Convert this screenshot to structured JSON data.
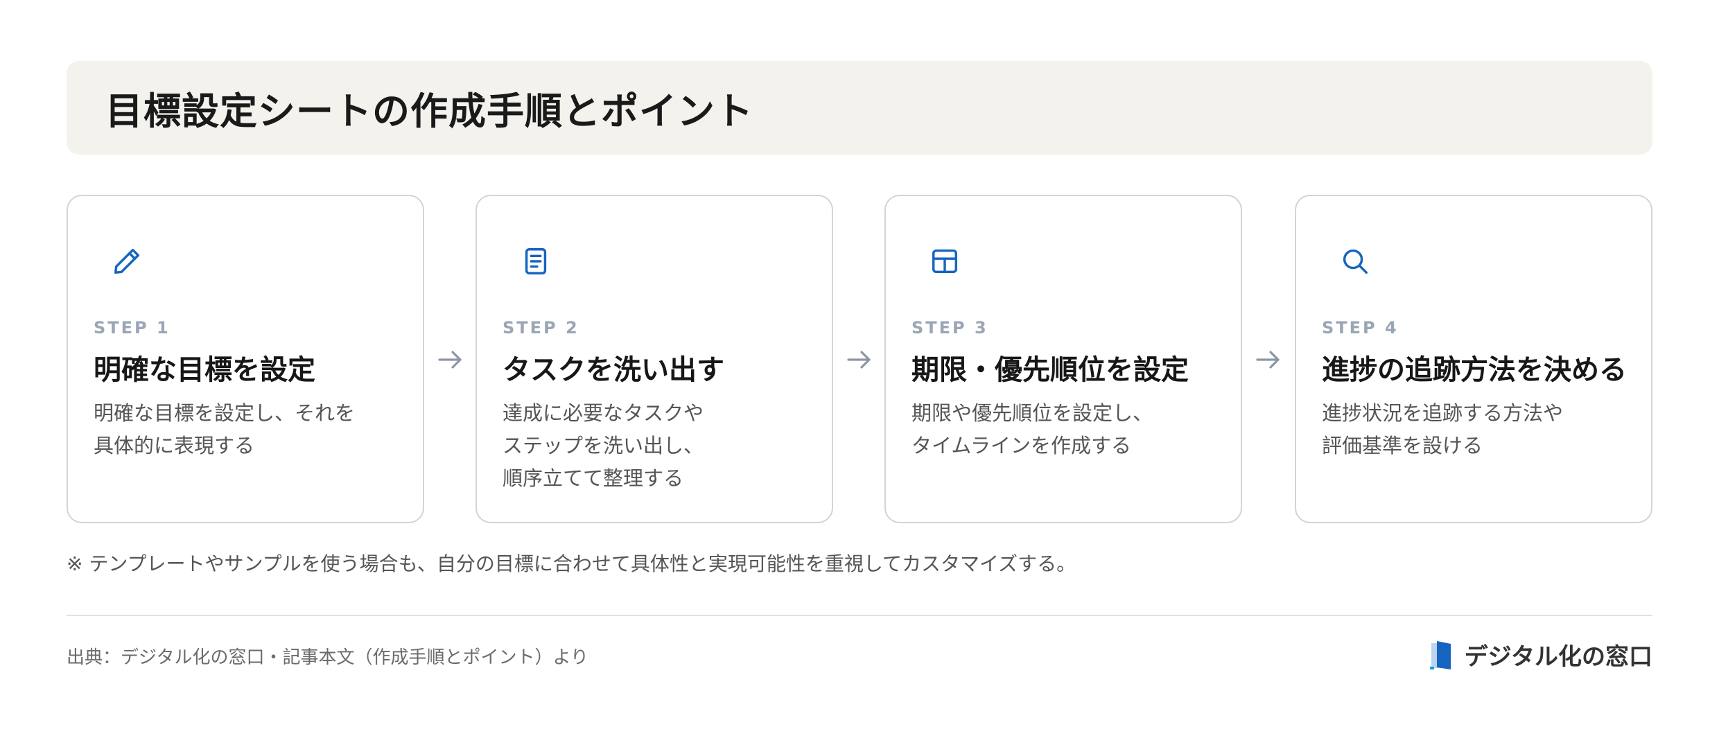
{
  "title": "目標設定シートの作成手順とポイント",
  "accent_color": "#1565c0",
  "steps": [
    {
      "icon": "pencil-icon",
      "label": "STEP 1",
      "title": "明確な目標を設定",
      "desc": [
        "明確な目標を設定し、それを",
        "具体的に表現する"
      ]
    },
    {
      "icon": "document-icon",
      "label": "STEP 2",
      "title": "タスクを洗い出す",
      "desc": [
        "達成に必要なタスクや",
        "ステップを洗い出し、",
        "順序立てて整理する"
      ]
    },
    {
      "icon": "table-icon",
      "label": "STEP 3",
      "title": "期限・優先順位を設定",
      "desc": [
        "期限や優先順位を設定し、",
        "タイムラインを作成する"
      ]
    },
    {
      "icon": "search-icon",
      "label": "STEP 4",
      "title": "進捗の追跡方法を決める",
      "desc": [
        "進捗状況を追跡する方法や",
        "評価基準を設ける"
      ]
    }
  ],
  "note": "※ テンプレートやサンプルを使う場合も、自分の目標に合わせて具体性と実現可能性を重視してカスタマイズする。",
  "source": "出典：デジタル化の窓口・記事本文（作成手順とポイント）より",
  "logo": {
    "icon": "door-logo-icon",
    "text": "デジタル化の窓口"
  }
}
